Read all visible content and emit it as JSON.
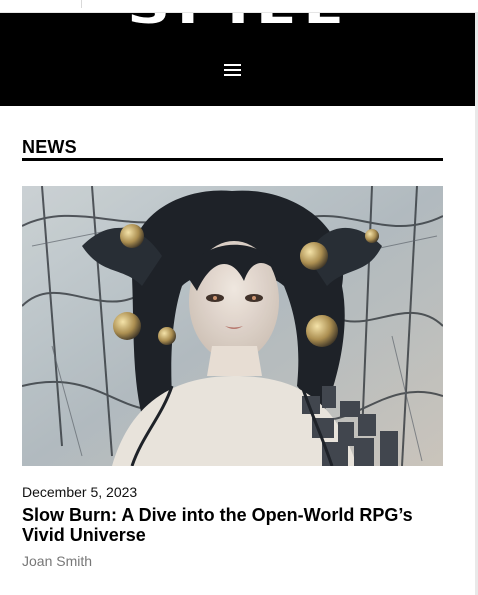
{
  "header": {
    "logo_text": "SPIEL",
    "menu_icon": "hamburger-menu-icon"
  },
  "section": {
    "title": "NEWS"
  },
  "article": {
    "image_icon": "article-illustration",
    "date": "December 5, 2023",
    "title": "Slow Burn: A Dive into the Open-World RPG’s Vivid Universe",
    "author": "Joan Smith"
  },
  "colors": {
    "header_bg": "#000000",
    "text": "#000000",
    "author_text": "#777777"
  }
}
